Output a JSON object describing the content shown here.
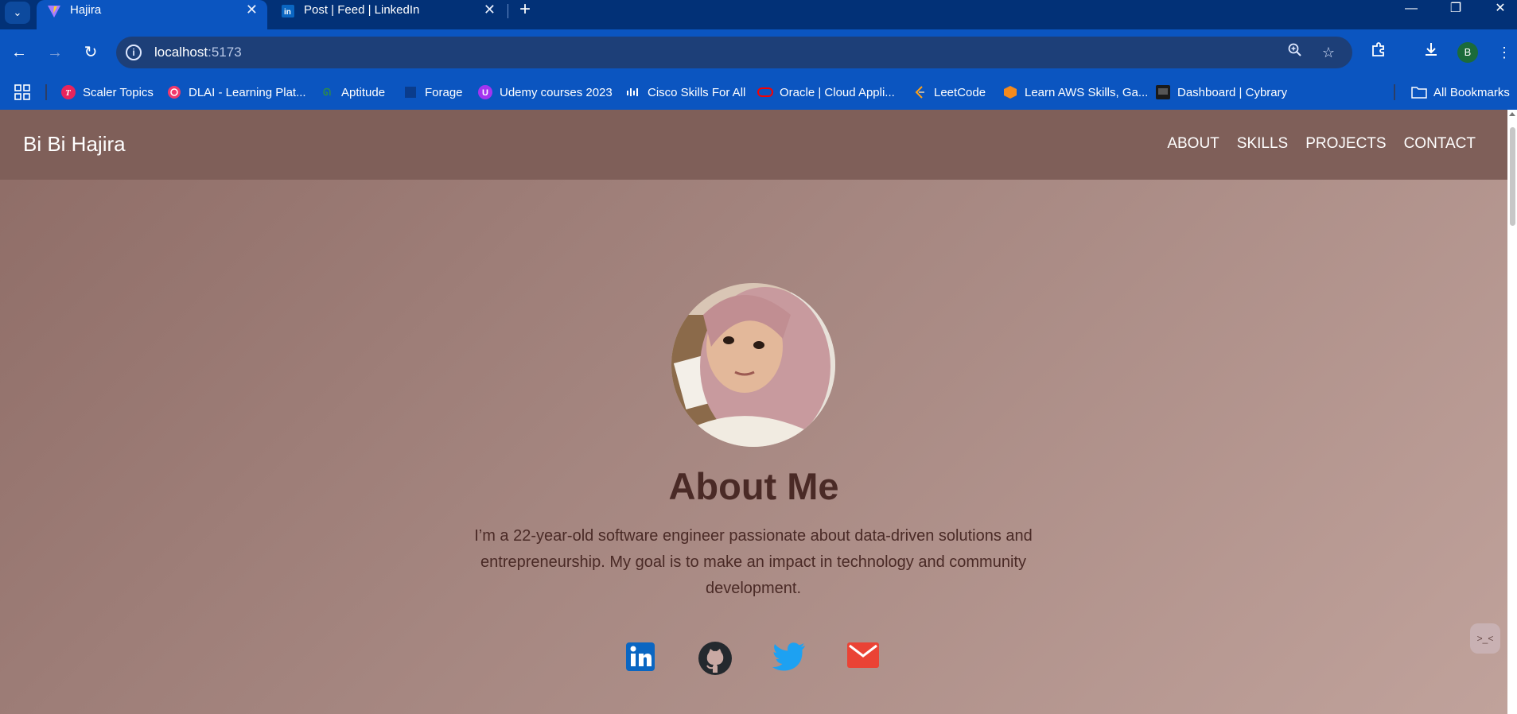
{
  "browser": {
    "tabs": [
      {
        "title": "Hajira",
        "active": true
      },
      {
        "title": "Post | Feed | LinkedIn",
        "active": false
      }
    ],
    "tab_close_glyph": "✕",
    "new_tab_glyph": "+",
    "window_controls": {
      "minimize": "—",
      "restore": "❐",
      "close": "✕"
    },
    "url_host": "localhost",
    "url_port": ":5173",
    "profile_initial": "B",
    "bookmarks": [
      "Scaler Topics",
      "DLAI - Learning Plat...",
      "Aptitude",
      "Forage",
      "Udemy courses 2023",
      "Cisco Skills For All",
      "Oracle | Cloud Appli...",
      "LeetCode",
      "Learn AWS Skills, Ga...",
      "Dashboard | Cybrary"
    ],
    "all_bookmarks": "All Bookmarks"
  },
  "site": {
    "brand": "Bi Bi Hajira",
    "nav": [
      "ABOUT",
      "SKILLS",
      "PROJECTS",
      "CONTACT"
    ],
    "about_title": "About Me",
    "about_text": "I’m a 22-year-old software engineer passionate about data-driven solutions and entrepreneurship. My goal is to make an impact in technology and community development.",
    "socials": [
      "linkedin-icon",
      "github-icon",
      "twitter-icon",
      "email-icon"
    ]
  },
  "colors": {
    "browser_frame": "#0b55c0",
    "tab_strip": "#023177",
    "header_bg": "#7f5f59",
    "text_dark": "#4a2a26",
    "linkedin": "#0a66c2",
    "github": "#24292e",
    "twitter": "#1da1f2",
    "email": "#ea4335"
  }
}
